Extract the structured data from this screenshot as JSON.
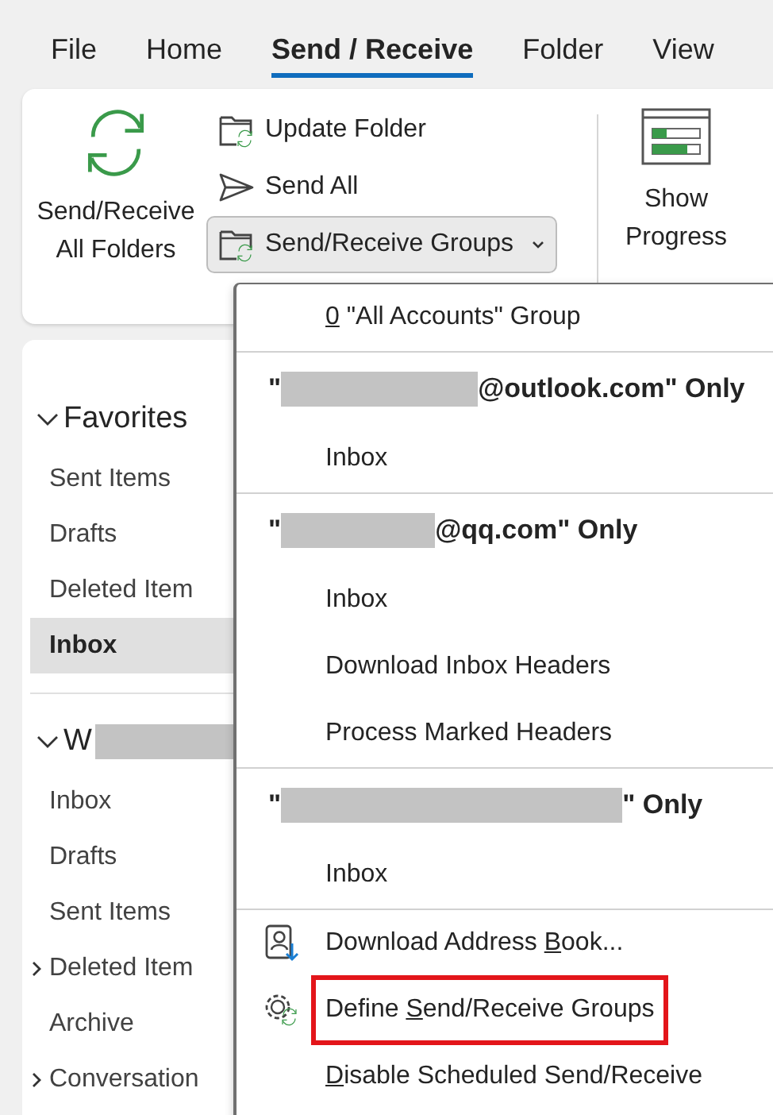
{
  "tabs": [
    {
      "label": "File",
      "selected": false
    },
    {
      "label": "Home",
      "selected": false
    },
    {
      "label": "Send / Receive",
      "selected": true
    },
    {
      "label": "Folder",
      "selected": false
    },
    {
      "label": "View",
      "selected": false
    }
  ],
  "ribbon": {
    "send_receive_all": {
      "label": "Send/Receive All Folders"
    },
    "small_buttons": [
      {
        "kind": "update",
        "label": "Update Folder",
        "expanded": false
      },
      {
        "kind": "send",
        "label": "Send All",
        "expanded": false
      },
      {
        "kind": "groups",
        "label": "Send/Receive Groups",
        "expanded": true
      }
    ],
    "show_progress": {
      "label": "Show Progress"
    }
  },
  "sidebar": {
    "sections": [
      {
        "title": "Favorites",
        "redacted": false,
        "expanded": true,
        "items": [
          {
            "label": "Sent Items",
            "selected": false,
            "has_subfolders": false
          },
          {
            "label": "Drafts",
            "selected": false,
            "has_subfolders": false
          },
          {
            "label": "Deleted Item",
            "selected": false,
            "has_subfolders": false
          },
          {
            "label": "Inbox",
            "selected": true,
            "has_subfolders": false
          }
        ]
      },
      {
        "title": "W",
        "redacted": true,
        "expanded": true,
        "items": [
          {
            "label": "Inbox",
            "selected": false,
            "has_subfolders": false
          },
          {
            "label": "Drafts",
            "selected": false,
            "has_subfolders": false
          },
          {
            "label": "Sent Items",
            "selected": false,
            "has_subfolders": false
          },
          {
            "label": "Deleted Item",
            "selected": false,
            "has_subfolders": true
          },
          {
            "label": "Archive",
            "selected": false,
            "has_subfolders": false
          },
          {
            "label": "Conversation",
            "selected": false,
            "has_subfolders": true
          }
        ]
      }
    ]
  },
  "menu": {
    "items": [
      {
        "kind": "item",
        "key": "0",
        "after": " \"All Accounts\" Group",
        "highlighted": false
      },
      {
        "kind": "separator"
      },
      {
        "kind": "header",
        "before": "\"",
        "after": "@outlook.com\" Only"
      },
      {
        "kind": "item",
        "before": "Inbox",
        "highlighted": false
      },
      {
        "kind": "separator"
      },
      {
        "kind": "header",
        "before": "\"",
        "after": "@qq.com\" Only"
      },
      {
        "kind": "item",
        "before": "Inbox",
        "highlighted": false
      },
      {
        "kind": "item",
        "before": "Download Inbox Headers",
        "highlighted": false
      },
      {
        "kind": "item",
        "before": "Process Marked Headers",
        "highlighted": false
      },
      {
        "kind": "separator"
      },
      {
        "kind": "header",
        "before": "\"",
        "after": "\" Only"
      },
      {
        "kind": "item",
        "before": "Inbox",
        "highlighted": false
      },
      {
        "kind": "separator"
      },
      {
        "kind": "item",
        "before": "Download Address ",
        "key": "B",
        "after": "ook...",
        "highlighted": false
      },
      {
        "kind": "item",
        "before": "Define ",
        "key": "S",
        "after": "end/Receive Groups",
        "highlighted": true
      },
      {
        "kind": "item",
        "key": "D",
        "after": "isable Scheduled Send/Receive",
        "highlighted": false
      }
    ]
  }
}
